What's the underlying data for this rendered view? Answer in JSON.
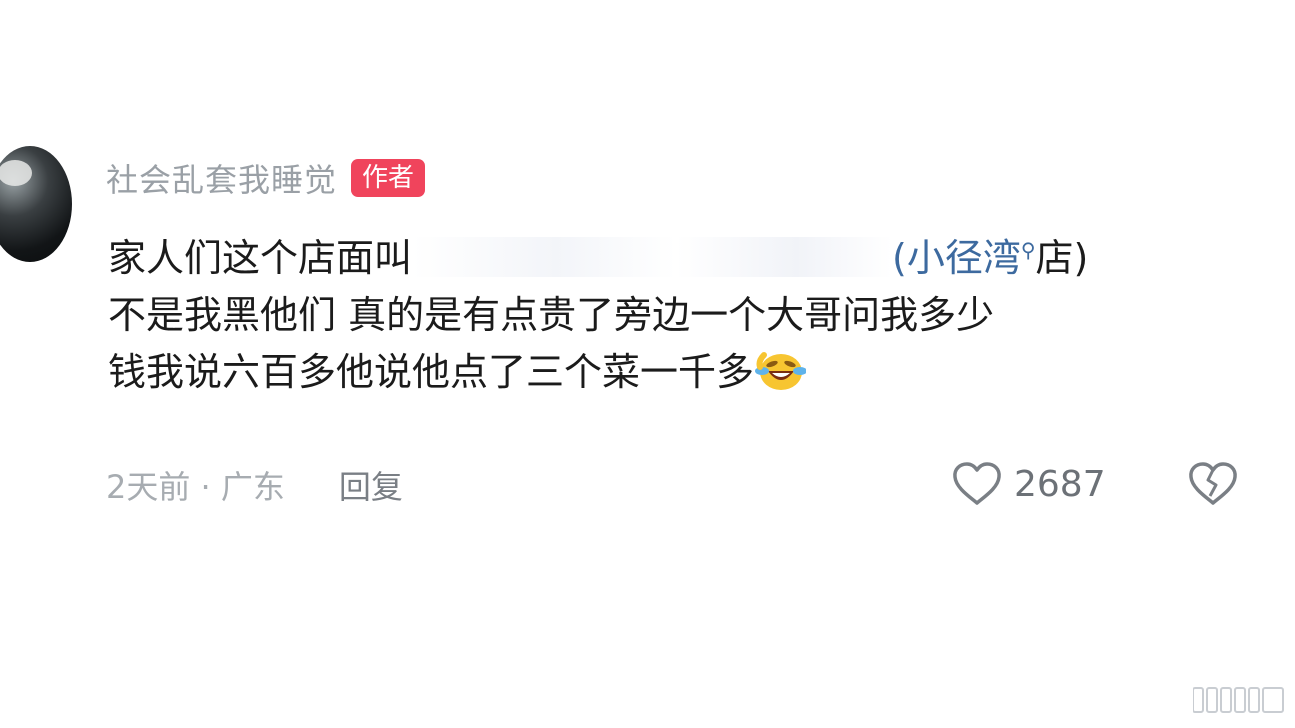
{
  "comment": {
    "username": "社会乱套我睡觉",
    "author_badge": "作者",
    "line1_prefix": "家人们这个店面叫",
    "location_link": "(小径湾",
    "line1_suffix": "店)",
    "line2": "不是我黑他们 真的是有点贵了旁边一个大哥问我多少",
    "line3": "钱我说六百多他说他点了三个菜一千多",
    "time_location": "2天前 · 广东",
    "reply_label": "回复",
    "like_count": "2687"
  },
  "icons": {
    "avatar": "user-avatar",
    "badge": "author-badge",
    "search": "search-icon",
    "emoji": "laughing-crying-emoji",
    "like": "heart-outline-icon",
    "dislike": "broken-heart-icon"
  },
  "colors": {
    "badge_bg": "#f0445c",
    "link": "#3d6a9f",
    "meta_text": "#a7acb1"
  }
}
